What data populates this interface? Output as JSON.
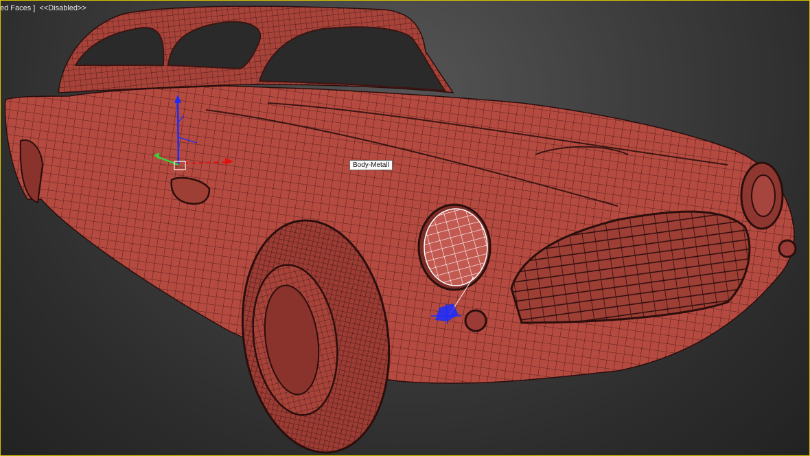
{
  "viewport": {
    "label_mode": "ed Faces ]",
    "label_status": "<<Disabled>>",
    "tooltip": "Body-Metall"
  },
  "colors": {
    "mesh_fill": "#b54a40",
    "mesh_line": "#3a1512",
    "selection": "#ffffff",
    "gizmo_blue": "#1a2cff",
    "gizmo_green": "#3ad13a",
    "gizmo_red": "#e01010",
    "viewport_border": "#d8c400"
  }
}
